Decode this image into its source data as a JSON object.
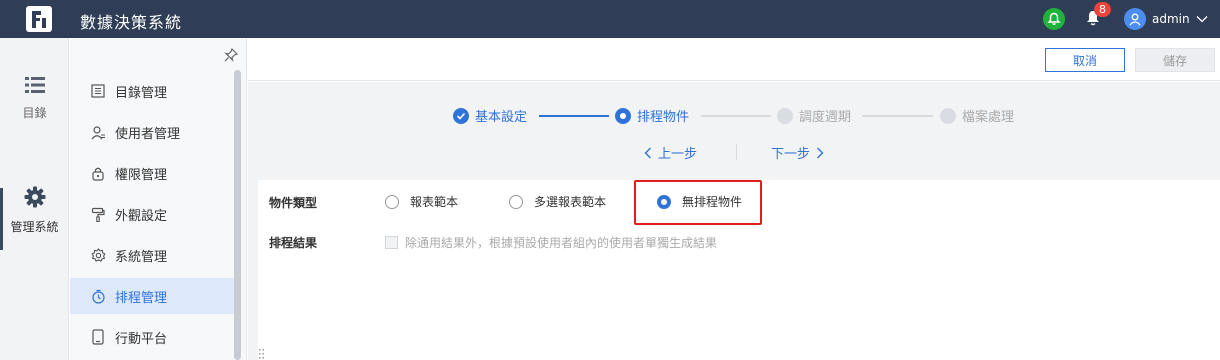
{
  "header": {
    "app_title": "數據決策系統",
    "notification_count": "8",
    "user_name": "admin"
  },
  "rail": {
    "items": [
      {
        "label": "目錄",
        "icon": "list-icon"
      },
      {
        "label": "管理系統",
        "icon": "gear-icon"
      }
    ]
  },
  "menu": {
    "items": [
      {
        "label": "目錄管理",
        "icon": "catalog-icon"
      },
      {
        "label": "使用者管理",
        "icon": "user-icon"
      },
      {
        "label": "權限管理",
        "icon": "lock-icon"
      },
      {
        "label": "外觀設定",
        "icon": "paint-roller-icon"
      },
      {
        "label": "系統管理",
        "icon": "gear-icon"
      },
      {
        "label": "排程管理",
        "icon": "timer-icon",
        "active": true
      },
      {
        "label": "行動平台",
        "icon": "mobile-icon"
      }
    ]
  },
  "actions": {
    "cancel_label": "取消",
    "save_label": "儲存"
  },
  "stepper": {
    "steps": [
      {
        "label": "基本設定",
        "state": "done"
      },
      {
        "label": "排程物件",
        "state": "current"
      },
      {
        "label": "調度週期",
        "state": "todo"
      },
      {
        "label": "檔案處理",
        "state": "todo"
      }
    ],
    "prev_label": "上一步",
    "next_label": "下一步"
  },
  "form": {
    "object_type_label": "物件類型",
    "object_type_options": [
      {
        "label": "報表範本",
        "checked": false
      },
      {
        "label": "多選報表範本",
        "checked": false
      },
      {
        "label": "無排程物件",
        "checked": true
      }
    ],
    "result_label": "排程結果",
    "result_checkbox_label": "除通用結果外，根據預設使用者組內的使用者單獨生成結果"
  },
  "colors": {
    "topbar": "#2f3e56",
    "accent": "#2f73d8",
    "highlight": "#e11e1e",
    "green_bell": "#1fb33c",
    "badge": "#e8453c"
  }
}
